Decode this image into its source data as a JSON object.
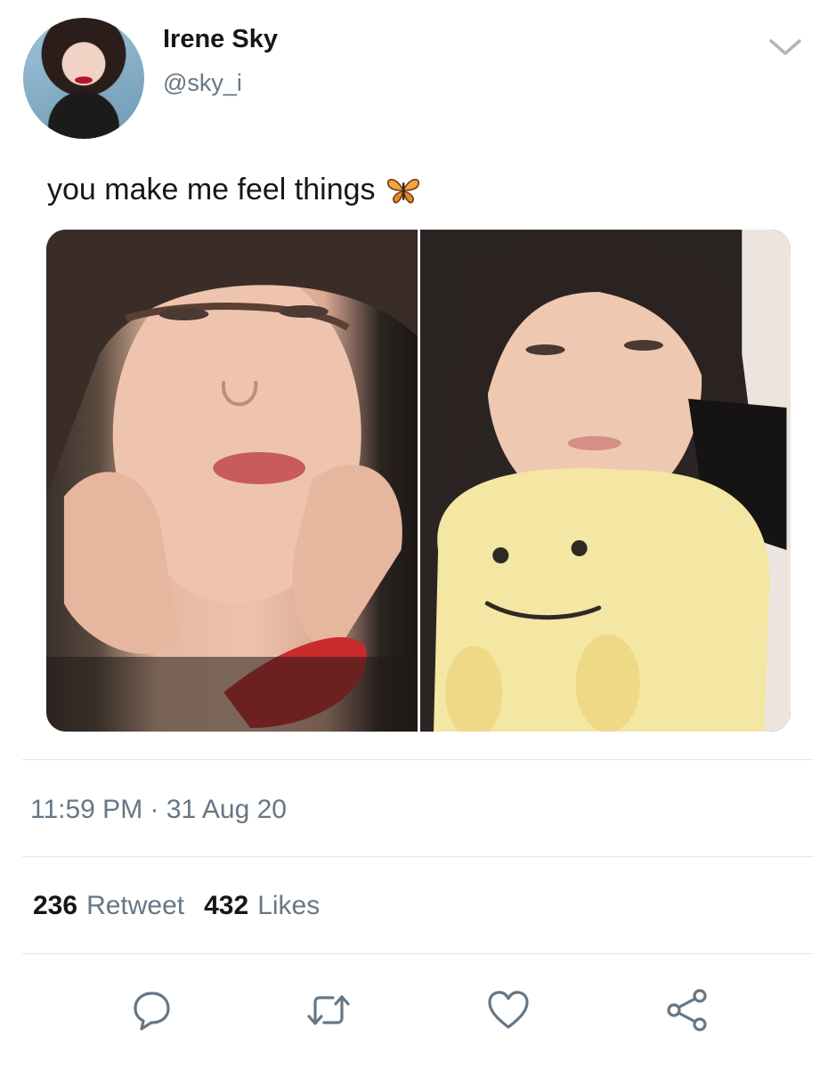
{
  "user": {
    "display_name": "Irene Sky",
    "handle": "@sky_i",
    "avatar_icon": "avatar"
  },
  "tweet": {
    "text": "you make me feel things",
    "emoji_icon": "butterfly-icon",
    "timestamp": "11:59 PM · 31 Aug 20"
  },
  "stats": {
    "retweets_count": "236",
    "retweets_label": "Retweet",
    "likes_count": "432",
    "likes_label": "Likes"
  },
  "actions": [
    "reply-icon",
    "retweet-icon",
    "like-icon",
    "share-icon"
  ],
  "colors": {
    "text": "#14171a",
    "secondary": "#657786",
    "divider": "#e1e8ed",
    "icon": "#657786"
  }
}
